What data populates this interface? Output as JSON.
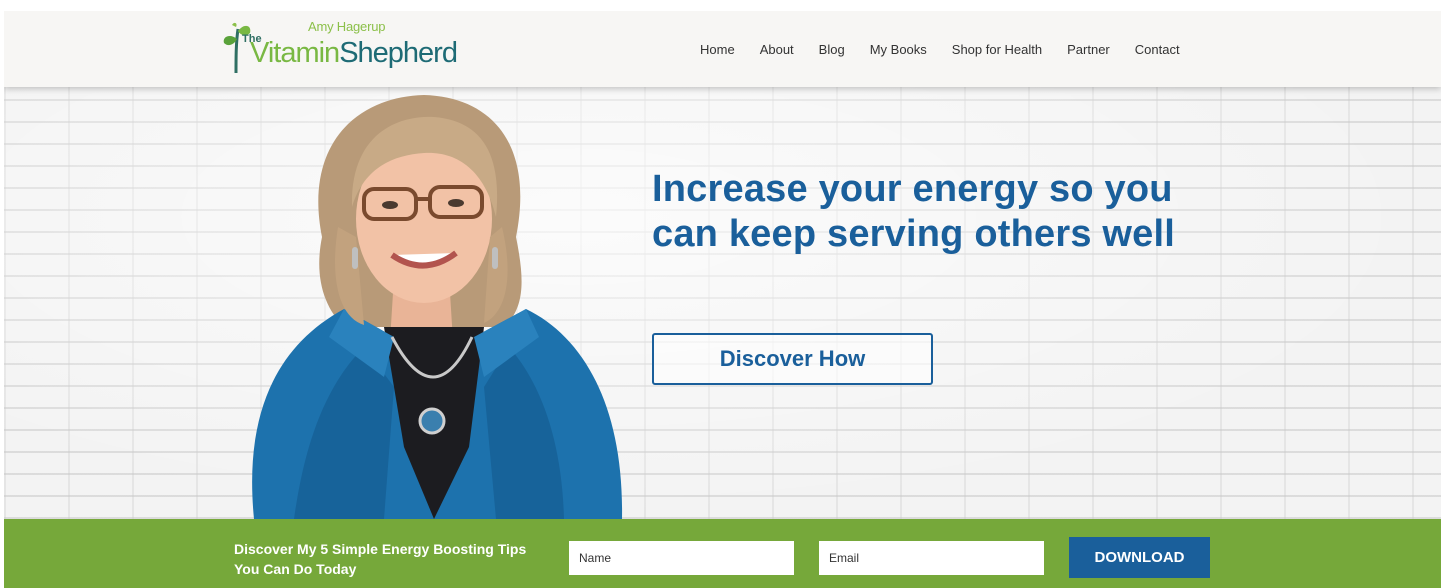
{
  "brand": {
    "tagline": "Amy Hagerup",
    "the": "The",
    "name_part1": "Vitamin",
    "name_part2": "Shepherd",
    "color_green": "#79b843",
    "color_teal": "#1e6b75"
  },
  "nav": {
    "items": [
      "Home",
      "About",
      "Blog",
      "My Books",
      "Shop for Health",
      "Partner",
      "Contact"
    ]
  },
  "hero": {
    "headline": "Increase your energy so you can keep serving others well",
    "cta_label": "Discover How",
    "accent_color": "#1a5f9b"
  },
  "optin": {
    "text": "Discover My 5 Simple Energy Boosting Tips You Can Do Today",
    "name_placeholder": "Name",
    "email_placeholder": "Email",
    "button_label": "DOWNLOAD",
    "bar_color": "#76a83a"
  }
}
